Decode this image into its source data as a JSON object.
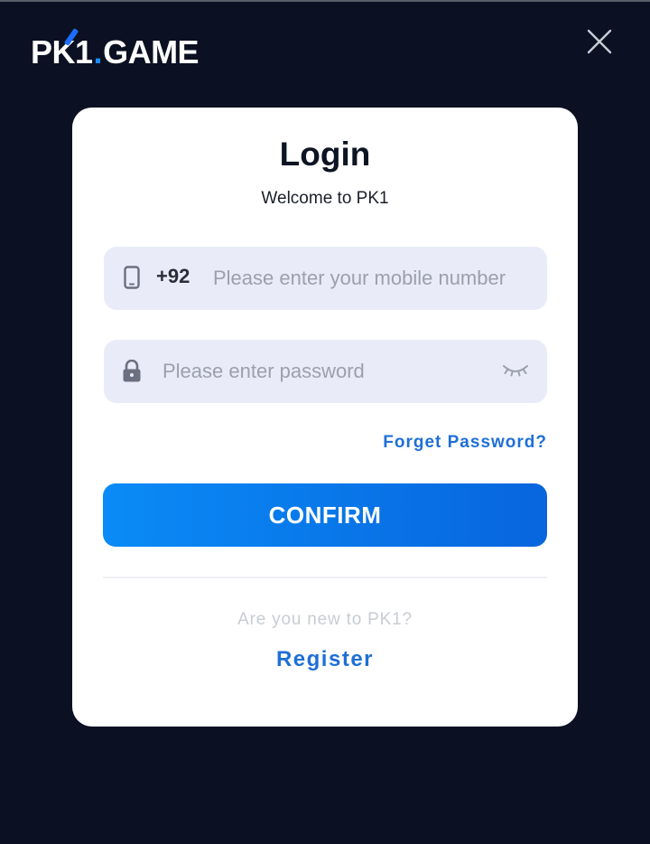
{
  "brand": {
    "logo_text": "PK1.GAME"
  },
  "header": {
    "close_icon": "close-icon"
  },
  "login": {
    "title": "Login",
    "subtitle": "Welcome to PK1",
    "phone": {
      "country_code": "+92",
      "placeholder": "Please enter your mobile number",
      "value": "",
      "icon": "phone-icon"
    },
    "password": {
      "placeholder": "Please enter password",
      "value": "",
      "icon": "lock-icon",
      "toggle_icon": "eye-closed-icon"
    },
    "forget_label": "Forget Password?",
    "confirm_label": "CONFIRM",
    "new_user_text": "Are you new to PK1?",
    "register_label": "Register"
  },
  "colors": {
    "background": "#0b1122",
    "card": "#ffffff",
    "accent": "#1f6fd6",
    "button_start": "#0a8bf6",
    "button_end": "#0865dd",
    "field_bg": "#e9ecf8"
  }
}
